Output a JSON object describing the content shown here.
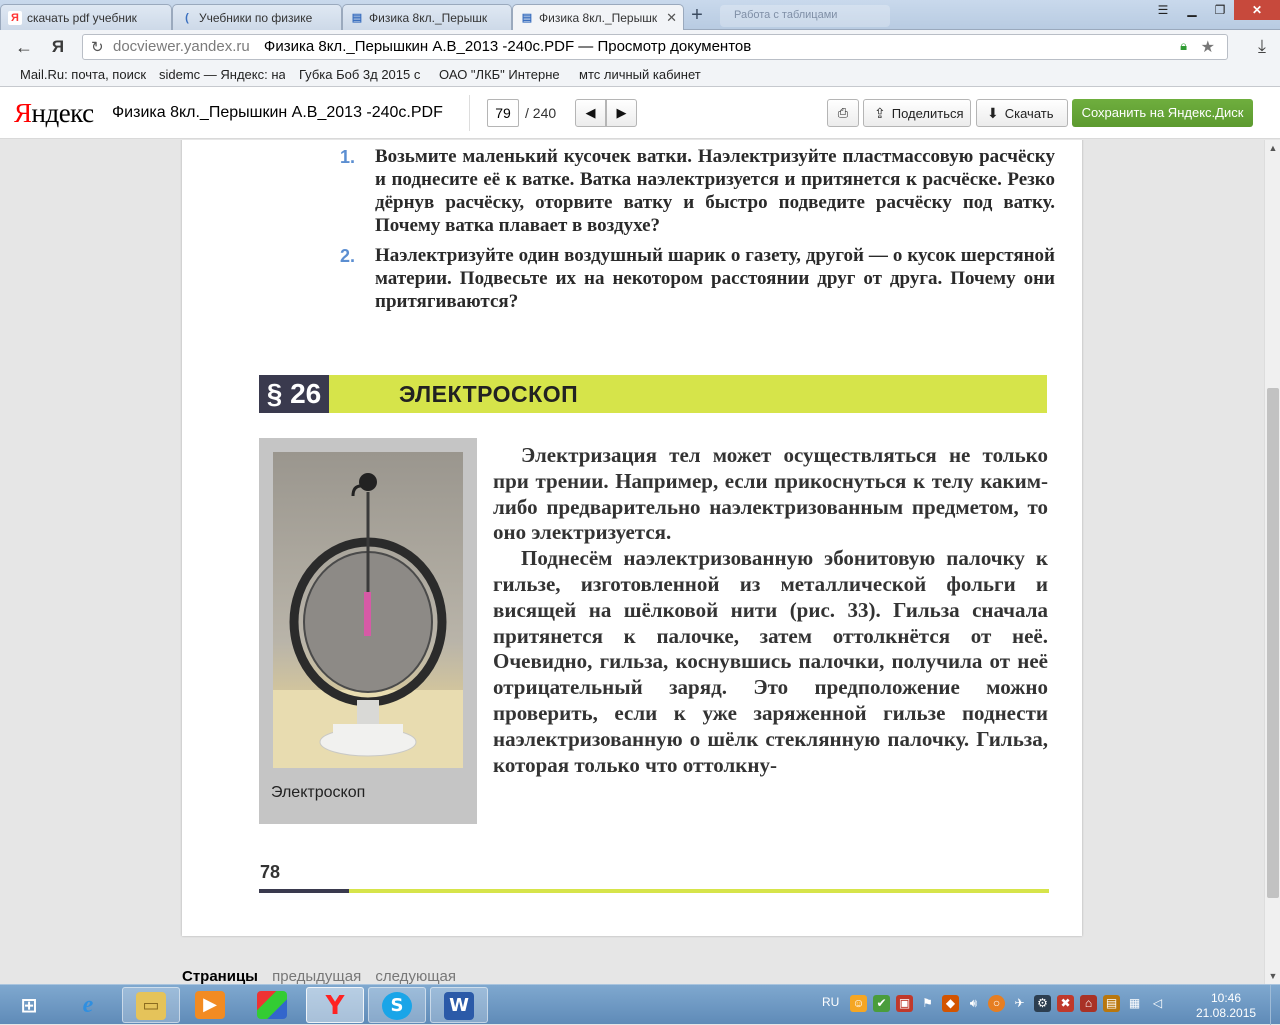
{
  "browser": {
    "tabs": [
      {
        "label": "скачать pdf учебник",
        "favicon": "Я",
        "favicon_color": "#f33"
      },
      {
        "label": "Учебники по физике",
        "favicon": "(",
        "favicon_color": "#3a6fbf"
      },
      {
        "label": "Физика 8кл._Перышк",
        "favicon": "▤",
        "favicon_color": "#3a6fbf"
      },
      {
        "label": "Физика 8кл._Перышк",
        "favicon": "▤",
        "favicon_color": "#3a6fbf"
      }
    ],
    "ghost_tab": "Работа с таблицами",
    "address": {
      "domain": "docviewer.yandex.ru",
      "title": "Физика 8кл._Перышкин А.В_2013 -240с.PDF — Просмотр документов"
    },
    "bookmarks": [
      "Mail.Ru: почта, поиск",
      "sidemc — Яндекс: на",
      "Губка Боб 3д 2015 с",
      "ОАО \"ЛКБ\" Интерне",
      "мтс личный кабинет"
    ]
  },
  "viewer": {
    "logo_first": "Я",
    "logo_rest": "ндекс",
    "doc_title": "Физика 8кл._Перышкин А.В_2013 -240с.PDF",
    "page_current": "79",
    "page_total": "/ 240",
    "share_label": "Поделиться",
    "download_label": "Скачать",
    "save_label": "Сохранить на Яндекс.Диск",
    "pages_label": "Страницы",
    "prev_label": "предыдущая",
    "next_label": "следующая"
  },
  "document": {
    "task1_num": "1.",
    "task1_text": "Возьмите маленький кусочек ватки. Наэлектризуйте пластмассовую расчёску и поднесите её к ватке. Ватка наэлектризуется и притянется к расчёске. Резко дёрнув расчёску, оторвите ватку и быстро подведите расчёску под ватку. Почему ватка плавает в воздухе?",
    "task2_num": "2.",
    "task2_text": "Наэлектризуйте один воздушный шарик о газету, другой — о кусок шерстяной материи. Подвесьте их на некотором расстоянии друг от друга. Почему они притягиваются?",
    "section_number": "§ 26",
    "section_title": "ЭЛЕКТРОСКОП",
    "figure_caption": "Электроскоп",
    "paragraph1": "Электризация тел может осуществляться не только при трении. Например, если прикоснуться к телу каким-либо предварительно наэлектризованным предметом, то оно электризуется.",
    "paragraph2": "Поднесём наэлектризованную эбонитовую палочку к гильзе, изготовленной из металлической фольги и висящей на шёлковой нити (рис. 33). Гильза сначала притянется к палочке, затем оттолкнётся от неё. Очевидно, гильза, коснувшись палочки, получила от неё отрицательный заряд. Это предположение можно проверить, если к уже заряженной гильзе поднести наэлектризованную о шёлк стеклянную палочку. Гильза, которая только что оттолкну-",
    "page_number": "78"
  },
  "taskbar": {
    "lang": "RU",
    "time": "10:46",
    "date": "21.08.2015"
  }
}
